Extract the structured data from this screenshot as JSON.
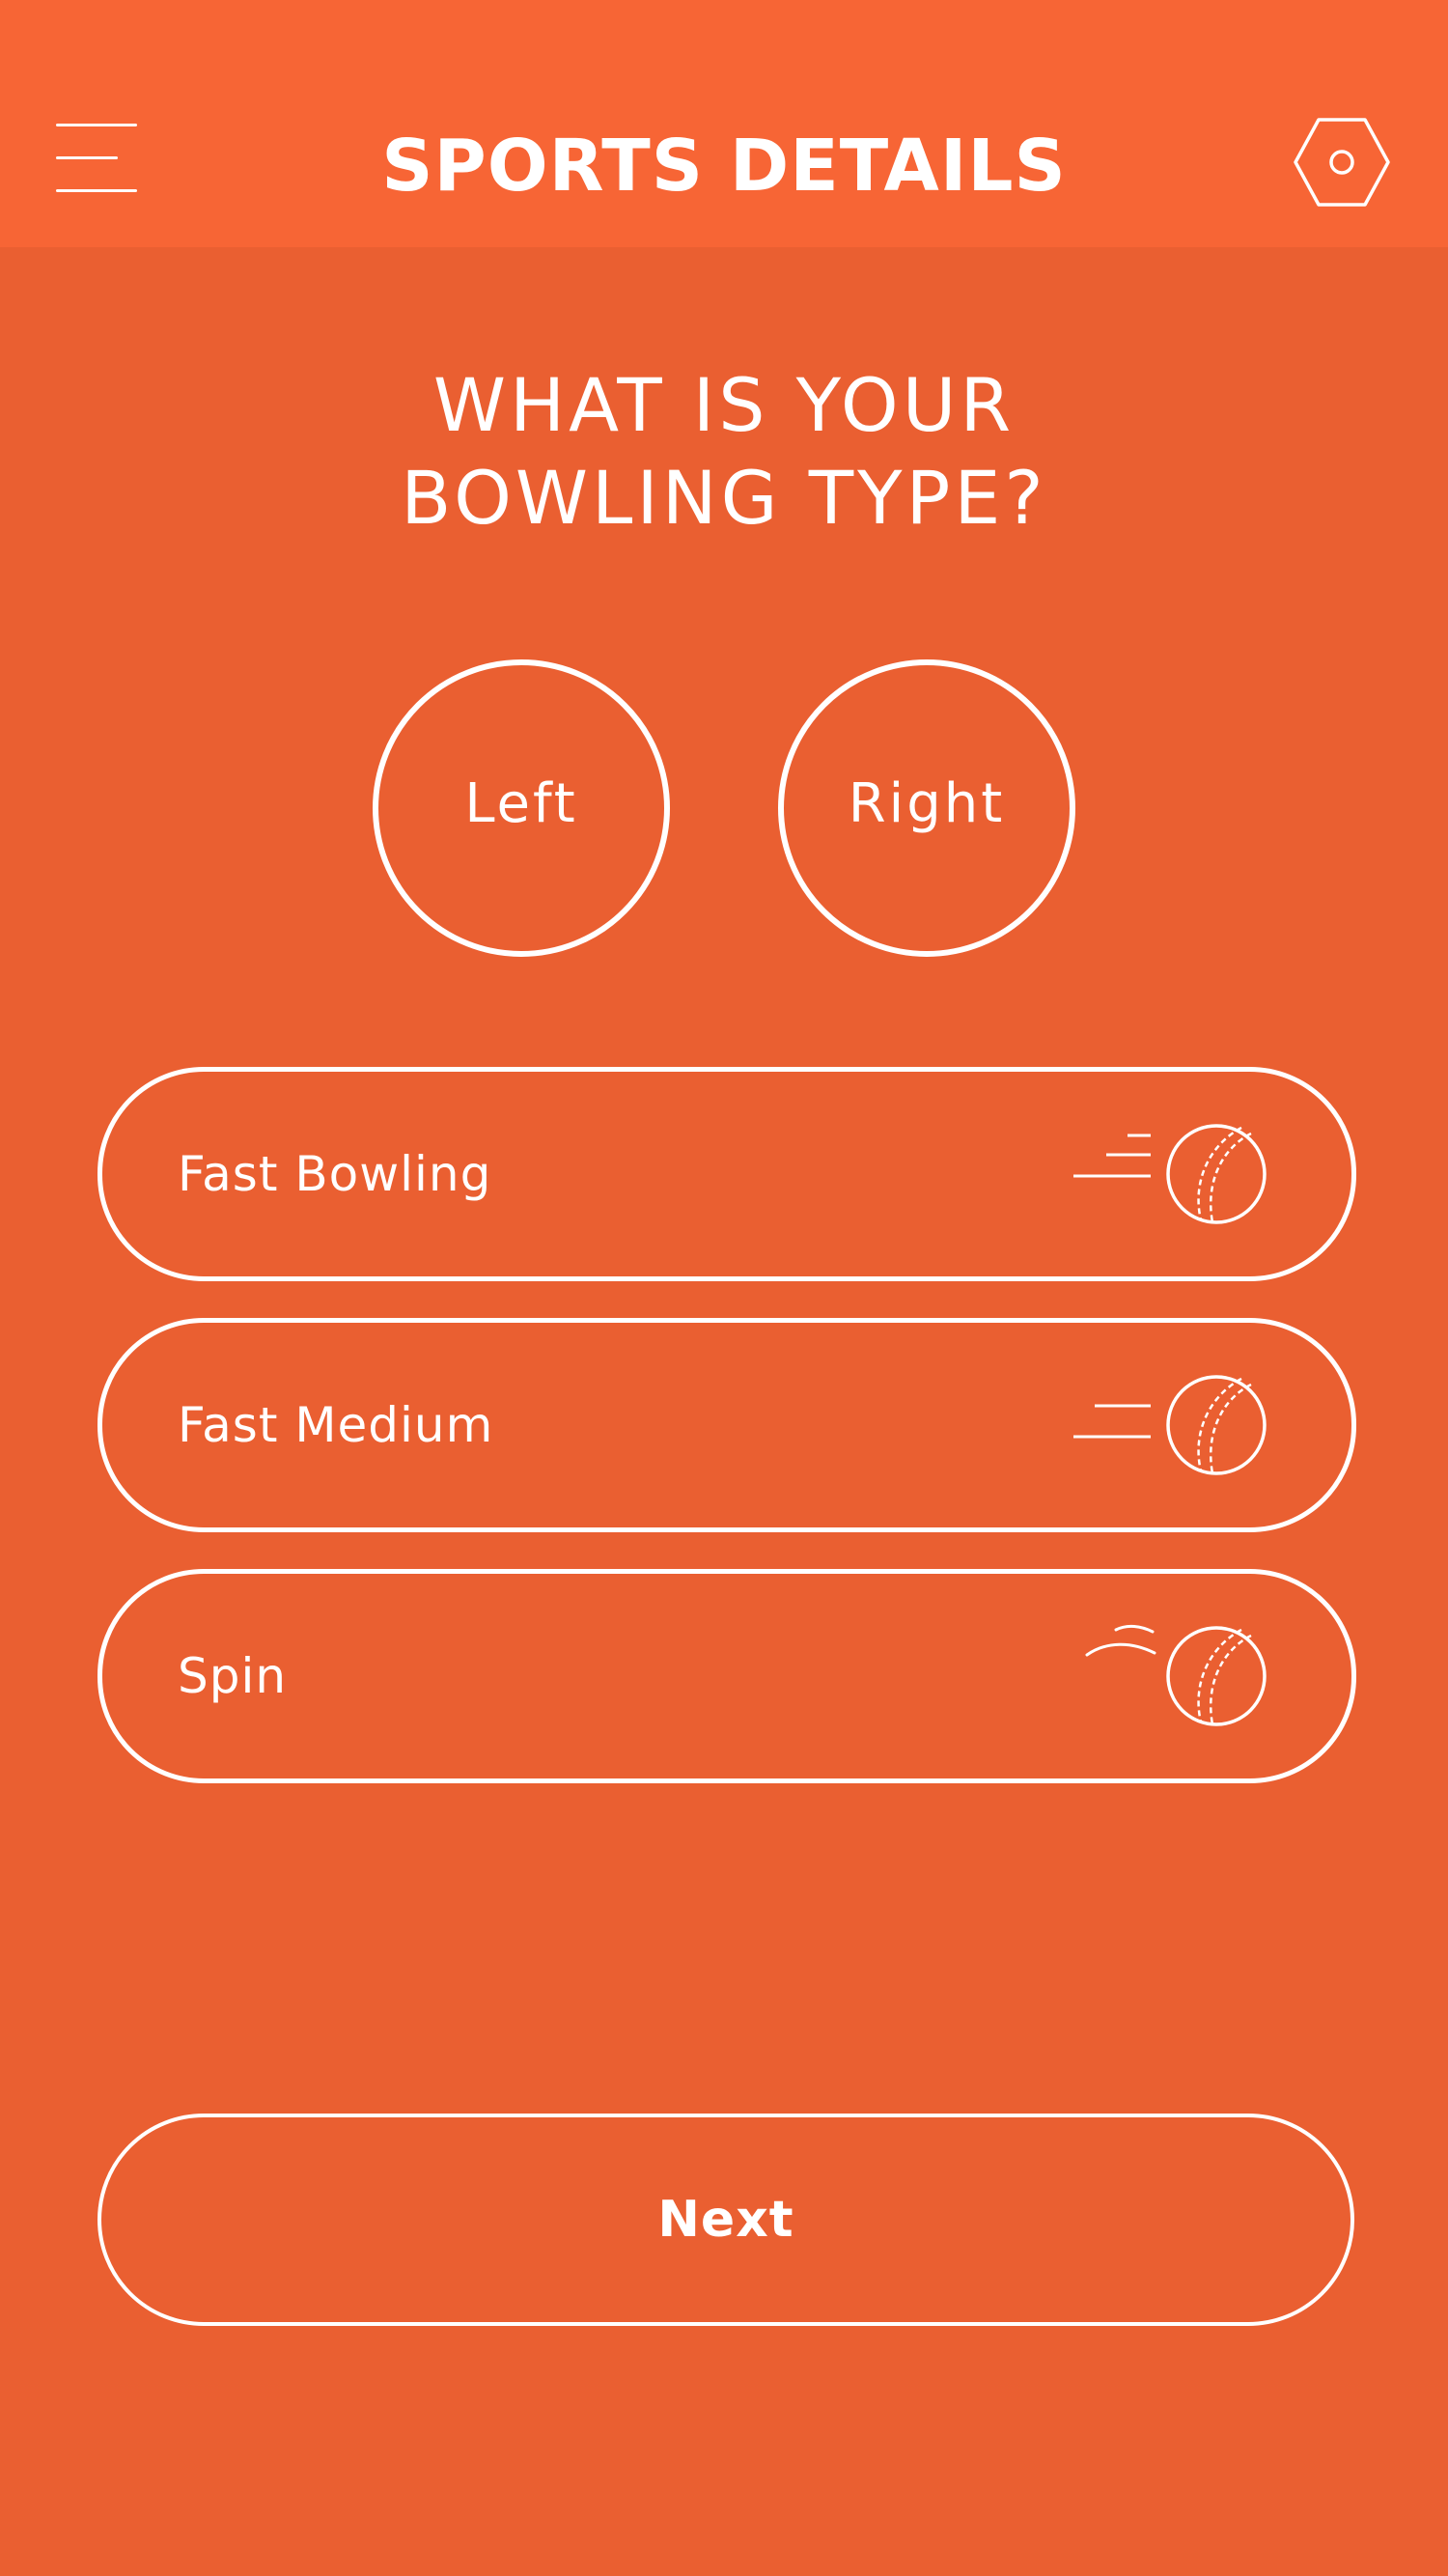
{
  "header": {
    "title": "SPORTS DETAILS",
    "menu_icon": "hamburger-menu-icon",
    "settings_icon": "hexagon-settings-icon"
  },
  "question": {
    "line1": "WHAT IS YOUR",
    "line2": "BOWLING TYPE?"
  },
  "arm_options": [
    {
      "label": "Left"
    },
    {
      "label": "Right"
    }
  ],
  "bowling_types": [
    {
      "label": "Fast Bowling",
      "icon": "fast-ball-icon"
    },
    {
      "label": "Fast Medium",
      "icon": "medium-ball-icon"
    },
    {
      "label": "Spin",
      "icon": "spin-ball-icon"
    }
  ],
  "next_label": "Next",
  "colors": {
    "background": "#EA5F31",
    "header_background": "#F76535",
    "foreground": "#FFFFFF"
  }
}
